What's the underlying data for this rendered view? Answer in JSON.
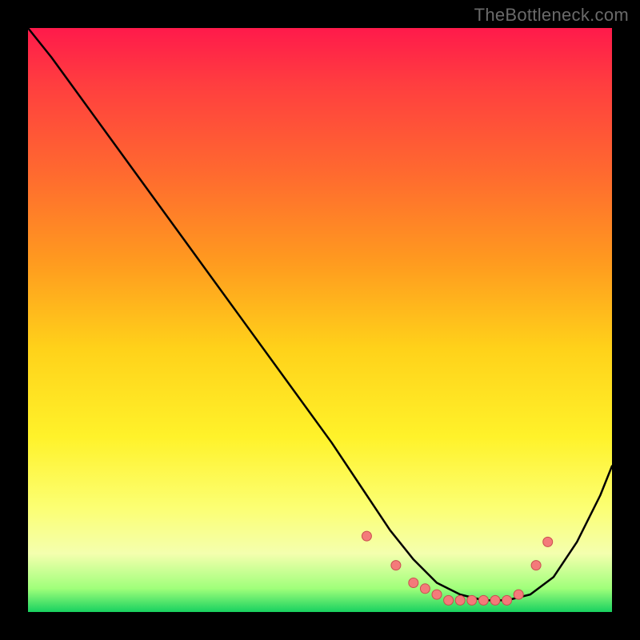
{
  "watermark": "TheBottleneck.com",
  "colors": {
    "background": "#000000",
    "curve_stroke": "#000000",
    "marker_fill": "#f47a7a",
    "marker_stroke": "#c94f4f"
  },
  "chart_data": {
    "type": "line",
    "title": "",
    "xlabel": "",
    "ylabel": "",
    "xlim": [
      0,
      100
    ],
    "ylim": [
      0,
      100
    ],
    "series": [
      {
        "name": "bottleneck-curve",
        "x": [
          0,
          4,
          12,
          20,
          28,
          36,
          44,
          52,
          58,
          62,
          66,
          70,
          74,
          78,
          82,
          86,
          90,
          94,
          98,
          100
        ],
        "y": [
          100,
          95,
          84,
          73,
          62,
          51,
          40,
          29,
          20,
          14,
          9,
          5,
          3,
          2,
          2,
          3,
          6,
          12,
          20,
          25
        ]
      }
    ],
    "markers": {
      "name": "highlight-dots",
      "x": [
        58,
        63,
        66,
        68,
        70,
        72,
        74,
        76,
        78,
        80,
        82,
        84,
        87,
        89
      ],
      "y": [
        13,
        8,
        5,
        4,
        3,
        2,
        2,
        2,
        2,
        2,
        2,
        3,
        8,
        12
      ]
    }
  }
}
